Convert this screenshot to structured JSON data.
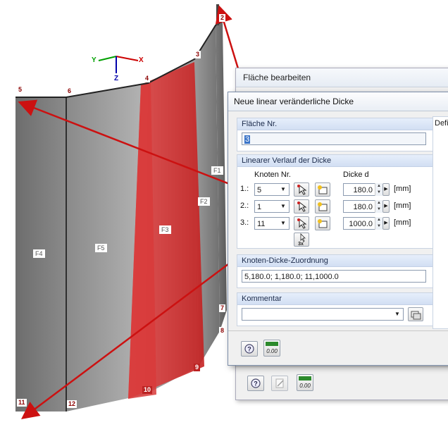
{
  "axes": {
    "x": "X",
    "y": "Y",
    "z": "Z"
  },
  "nodes": [
    "1",
    "2",
    "3",
    "4",
    "5",
    "6",
    "7",
    "8",
    "9",
    "10",
    "11",
    "12"
  ],
  "faces": [
    "F1",
    "F2",
    "F3",
    "F4",
    "F5"
  ],
  "back_dialog": {
    "title": "Fläche bearbeiten"
  },
  "dialog": {
    "title": "Neue linear veränderliche Dicke",
    "surface_group": {
      "header": "Fläche Nr.",
      "value": "3"
    },
    "linear_group": {
      "header": "Linearer Verlauf der Dicke",
      "col_nodes": "Knoten Nr.",
      "col_thickness": "Dicke d",
      "rows": [
        {
          "index": "1.:",
          "node": "5",
          "thickness": "180.0",
          "unit": "[mm]"
        },
        {
          "index": "2.:",
          "node": "1",
          "thickness": "180.0",
          "unit": "[mm]"
        },
        {
          "index": "3.:",
          "node": "11",
          "thickness": "1000.0",
          "unit": "[mm]"
        }
      ],
      "pick3_label": "3x"
    },
    "assignment_group": {
      "header": "Knoten-Dicke-Zuordnung",
      "value": "5,180.0; 1,180.0; 11,1000.0"
    },
    "comment_group": {
      "header": "Kommentar",
      "value": ""
    },
    "side_label": "Defi",
    "footer_value": "0.00"
  },
  "back_footer_value": "0.00",
  "colors": {
    "red_face": "#e03030",
    "grey_face": "#7d7d7d",
    "arrow": "#cc1111"
  }
}
